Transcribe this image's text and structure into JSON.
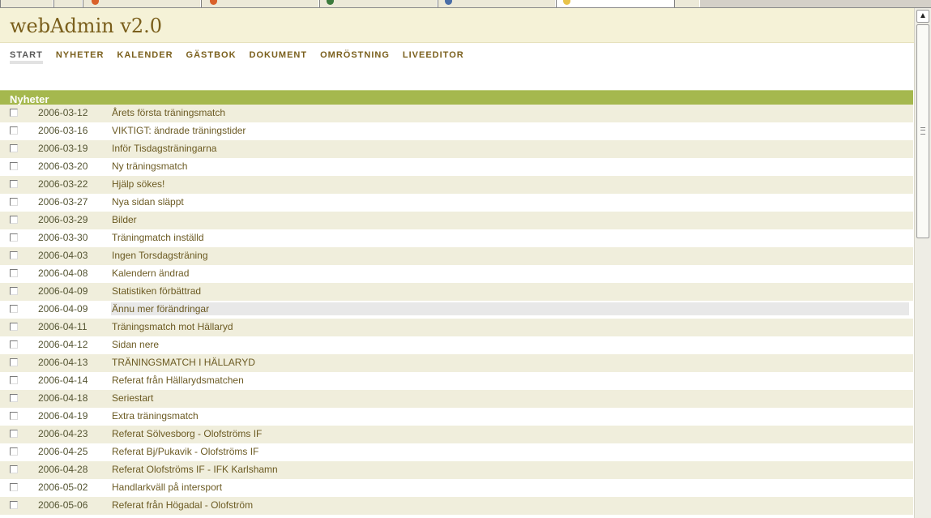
{
  "app": {
    "title": "webAdmin v2.0"
  },
  "nav": [
    {
      "label": "START",
      "active": true
    },
    {
      "label": "NYHETER",
      "active": false
    },
    {
      "label": "KALENDER",
      "active": false
    },
    {
      "label": "GÄSTBOK",
      "active": false
    },
    {
      "label": "DOKUMENT",
      "active": false
    },
    {
      "label": "OMRÖSTNING",
      "active": false
    },
    {
      "label": "LIVEEDITOR",
      "active": false
    }
  ],
  "section": {
    "title": "Nyheter"
  },
  "news": [
    {
      "date": "2006-03-12",
      "title": "Årets första träningsmatch"
    },
    {
      "date": "2006-03-16",
      "title": "VIKTIGT: ändrade träningstider"
    },
    {
      "date": "2006-03-19",
      "title": "Inför Tisdagsträningarna"
    },
    {
      "date": "2006-03-20",
      "title": "Ny träningsmatch"
    },
    {
      "date": "2006-03-22",
      "title": "Hjälp sökes!"
    },
    {
      "date": "2006-03-27",
      "title": "Nya sidan släppt"
    },
    {
      "date": "2006-03-29",
      "title": "Bilder"
    },
    {
      "date": "2006-03-30",
      "title": "Träningmatch inställd"
    },
    {
      "date": "2006-04-03",
      "title": "Ingen Torsdagsträning"
    },
    {
      "date": "2006-04-08",
      "title": "Kalendern ändrad"
    },
    {
      "date": "2006-04-09",
      "title": "Statistiken förbättrad"
    },
    {
      "date": "2006-04-09",
      "title": "Ännu mer förändringar"
    },
    {
      "date": "2006-04-11",
      "title": "Träningsmatch mot Hällaryd"
    },
    {
      "date": "2006-04-12",
      "title": "Sidan nere"
    },
    {
      "date": "2006-04-13",
      "title": "TRÄNINGSMATCH I HÄLLARYD"
    },
    {
      "date": "2006-04-14",
      "title": "Referat från Hällarydsmatchen"
    },
    {
      "date": "2006-04-18",
      "title": "Seriestart"
    },
    {
      "date": "2006-04-19",
      "title": "Extra träningsmatch"
    },
    {
      "date": "2006-04-23",
      "title": "Referat Sölvesborg - Olofströms IF"
    },
    {
      "date": "2006-04-25",
      "title": "Referat Bj/Pukavik - Olofströms IF"
    },
    {
      "date": "2006-04-28",
      "title": "Referat Olofströms IF - IFK Karlshamn"
    },
    {
      "date": "2006-05-02",
      "title": "Handlarkväll på intersport"
    },
    {
      "date": "2006-05-06",
      "title": "Referat från Högadal - Olofström"
    }
  ],
  "hovered_row": 11,
  "colors": {
    "header_bg": "#f5f2d7",
    "brand": "#7a5f1c",
    "section_bar": "#a5b84e",
    "row_alt": "#f0eedc",
    "hover": "#e8e8e8"
  }
}
